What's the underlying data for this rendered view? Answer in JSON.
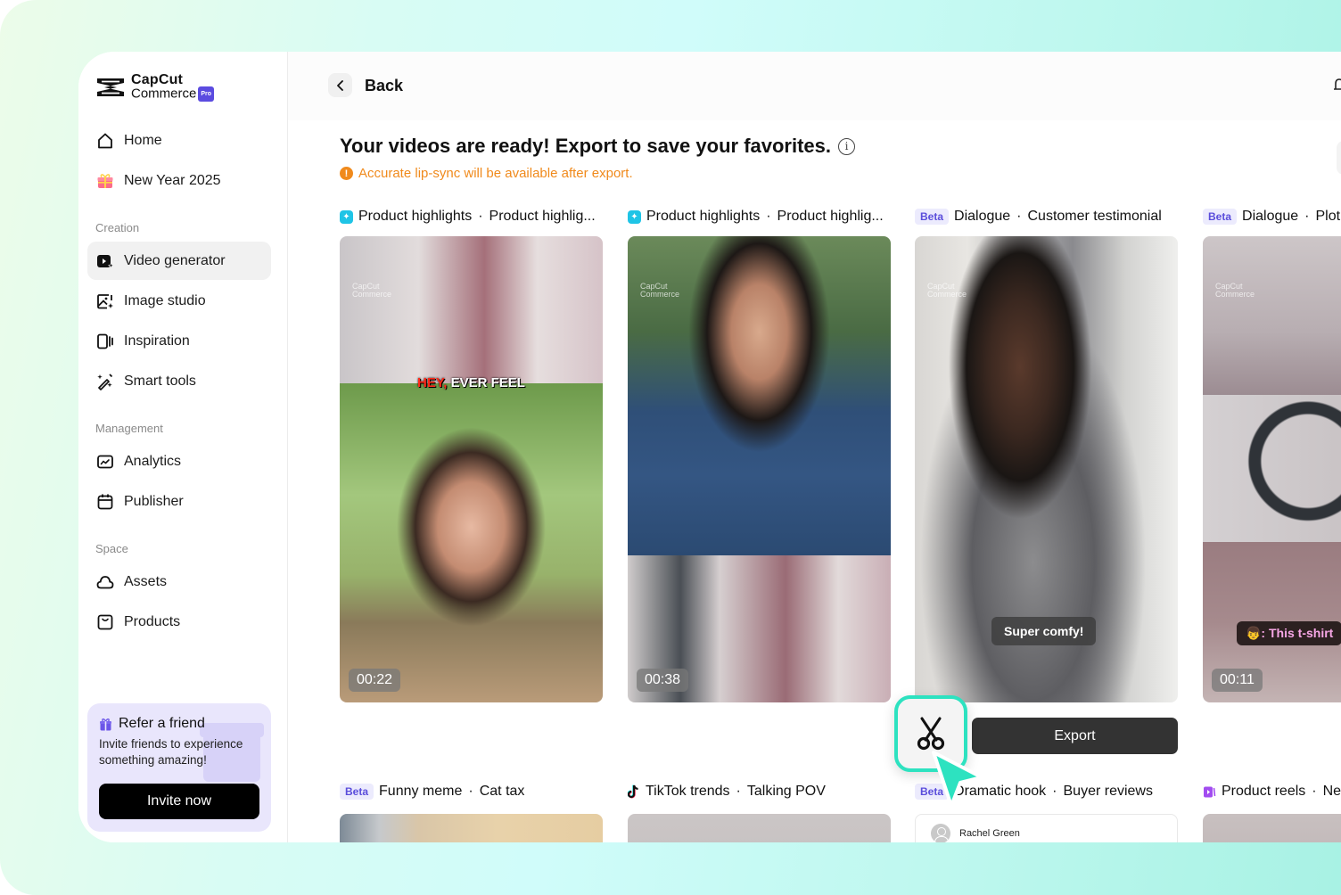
{
  "brand": {
    "name_line1": "CapCut",
    "name_line2": "Commerce",
    "badge": "Pro",
    "badge_color": "#5b4be0"
  },
  "sidebar": {
    "top_items": [
      {
        "label": "Home",
        "icon": "home-icon"
      },
      {
        "label": "New Year 2025",
        "icon": "gift-icon"
      }
    ],
    "sections": [
      {
        "label": "Creation",
        "items": [
          {
            "label": "Video generator",
            "icon": "video-generator-icon",
            "active": true
          },
          {
            "label": "Image studio",
            "icon": "image-studio-icon"
          },
          {
            "label": "Inspiration",
            "icon": "inspiration-icon"
          },
          {
            "label": "Smart tools",
            "icon": "magic-wand-icon"
          }
        ]
      },
      {
        "label": "Management",
        "items": [
          {
            "label": "Analytics",
            "icon": "analytics-icon"
          },
          {
            "label": "Publisher",
            "icon": "calendar-icon"
          }
        ]
      },
      {
        "label": "Space",
        "items": [
          {
            "label": "Assets",
            "icon": "cloud-icon"
          },
          {
            "label": "Products",
            "icon": "bag-icon"
          }
        ]
      }
    ],
    "refer": {
      "title": "Refer a friend",
      "description": "Invite friends to experience something amazing!",
      "button": "Invite now",
      "bg_color": "#e9e6fc"
    }
  },
  "header": {
    "back_label": "Back"
  },
  "main": {
    "title": "Your videos are ready! Export to save your favorites.",
    "info_glyph": "i",
    "warning": "Accurate lip-sync will be available after export.",
    "warning_color": "#f08a1c",
    "export_label": "Export",
    "videos": [
      {
        "badge": "",
        "icon": "sparkle-icon",
        "category": "Product highlights",
        "name": "Product highlig...",
        "duration": "00:22",
        "caption_red": "HEY,",
        "caption_white": "EVER FEEL"
      },
      {
        "badge": "",
        "icon": "sparkle-icon",
        "category": "Product highlights",
        "name": "Product highlig...",
        "duration": "00:38"
      },
      {
        "badge": "Beta",
        "category": "Dialogue",
        "name": "Customer testimonial",
        "caption": "Super comfy!"
      },
      {
        "badge": "Beta",
        "category": "Dialogue",
        "name": "Plot t",
        "duration": "00:11",
        "caption": "👦: This t-shirt"
      }
    ],
    "videos_row2": [
      {
        "badge": "Beta",
        "category": "Funny meme",
        "name": "Cat tax"
      },
      {
        "badge": "",
        "icon": "tiktok-icon",
        "category": "TikTok trends",
        "name": "Talking POV"
      },
      {
        "badge": "Beta",
        "category": "Dramatic hook",
        "name": "Buyer reviews",
        "reviewer": "Rachel Green"
      },
      {
        "badge": "",
        "icon": "product-reels-icon",
        "category": "Product reels",
        "name": "New"
      }
    ],
    "separator": "·"
  }
}
